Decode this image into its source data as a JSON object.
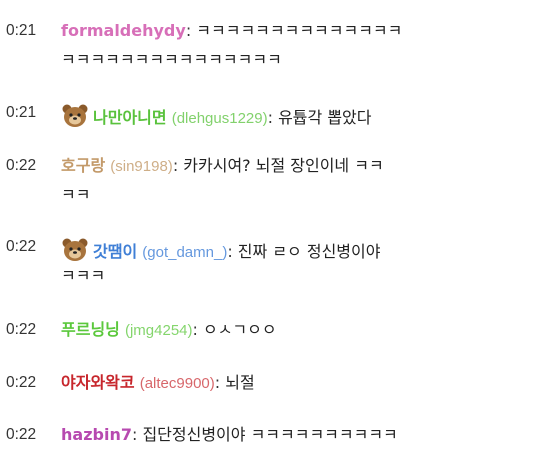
{
  "messages": [
    {
      "time": "0:21",
      "nick": "formaldehydy",
      "uid": "",
      "colon": ":",
      "text": " ㅋㅋㅋㅋㅋㅋㅋㅋㅋㅋㅋㅋㅋㅋ",
      "cont": "ㅋㅋㅋㅋㅋㅋㅋㅋㅋㅋㅋㅋㅋㅋㅋ",
      "color": "#d76fb8"
    },
    {
      "time": "0:21",
      "nick": "나만아니면",
      "uid": "(dlehgus1229)",
      "colon": ":",
      "text": " 유튭각 뽑았다",
      "cont": "",
      "color": "#59c23c"
    },
    {
      "time": "0:22",
      "nick": "호구랑",
      "uid": "(sin9198)",
      "colon": ":",
      "text": " 카카시여? 뇌절 장인이네 ㅋㅋ",
      "cont": "ㅋㅋ",
      "color": "#c39a6a"
    },
    {
      "time": "0:22",
      "nick": "갓땜이",
      "uid": "(got_damn_)",
      "colon": ":",
      "text": " 진짜 ㄹㅇ 정신병이야",
      "cont": "ㅋㅋㅋ",
      "color": "#3f7fd6"
    },
    {
      "time": "0:22",
      "nick": "푸르닝닝",
      "uid": "(jmg4254)",
      "colon": ":",
      "text": " ㅇㅅㄱㅇㅇ",
      "cont": "",
      "color": "#5bc83c"
    },
    {
      "time": "0:22",
      "nick": "야자와왁코",
      "uid": "(altec9900)",
      "colon": ":",
      "text": " 뇌절",
      "cont": "",
      "color": "#c7262c"
    },
    {
      "time": "0:22",
      "nick": "hazbin7",
      "uid": "",
      "colon": ":",
      "text": " 집단정신병이야 ㅋㅋㅋㅋㅋㅋㅋㅋㅋㅋ",
      "cont": "",
      "color": "#b74ab0"
    }
  ]
}
